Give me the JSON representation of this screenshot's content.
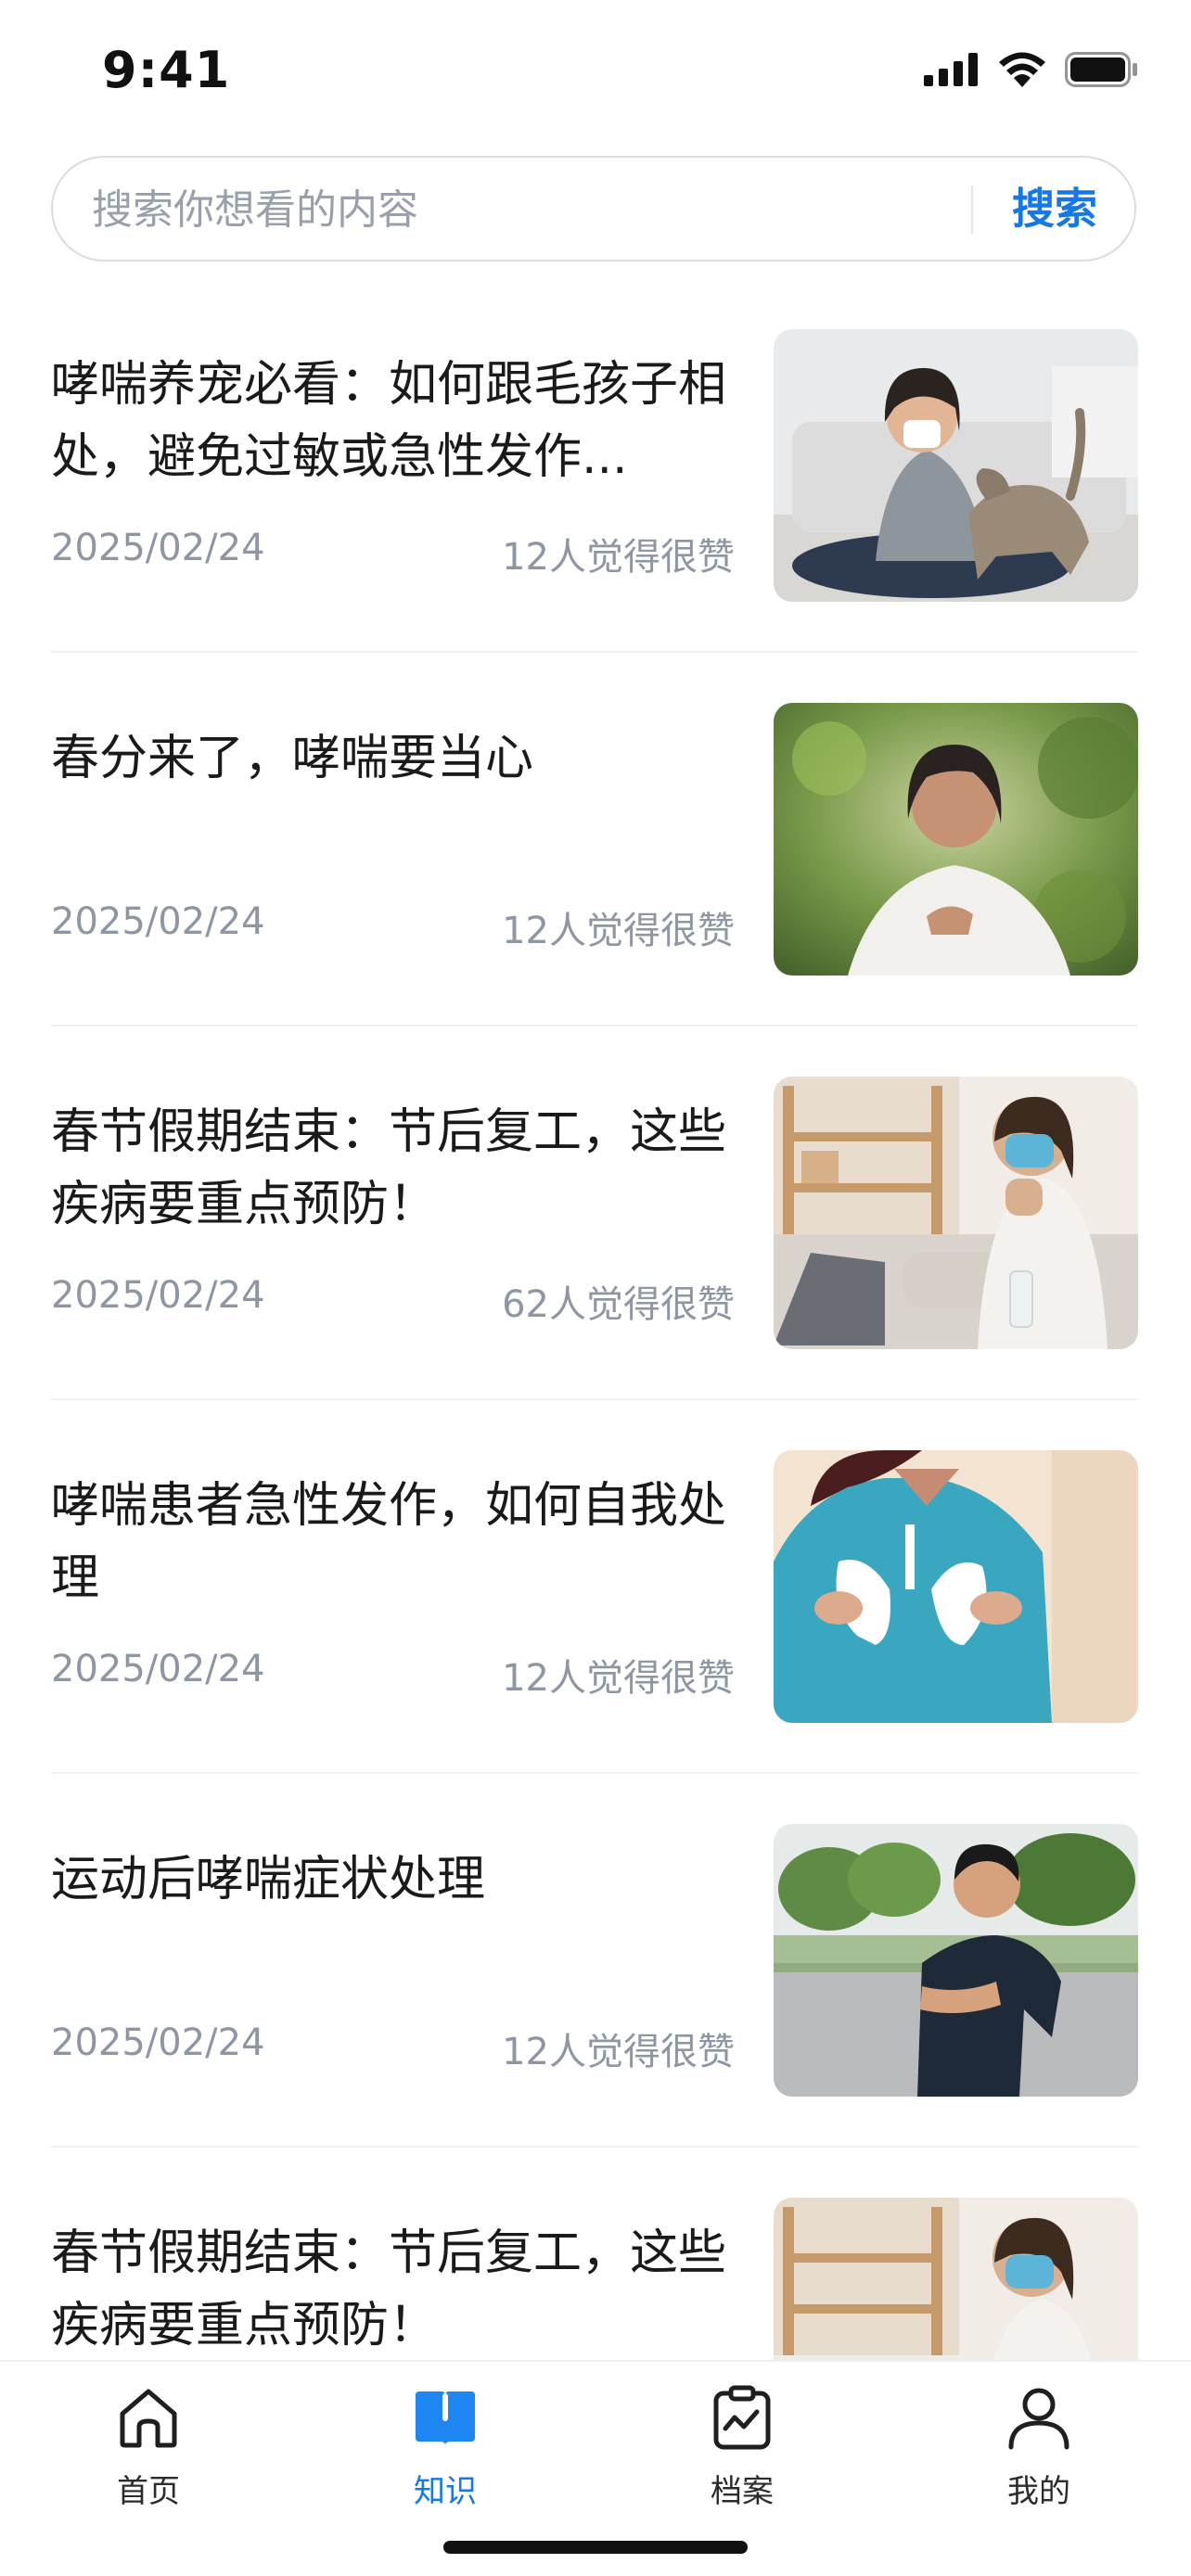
{
  "status_bar": {
    "time": "9:41"
  },
  "search": {
    "placeholder": "搜索你想看的内容",
    "button_label": "搜索"
  },
  "articles": [
    {
      "title": "哮喘养宠必看：如何跟毛孩子相处，避免过敏或急性发作...",
      "date": "2025/02/24",
      "likes": "12人觉得很赞",
      "image": "woman-sneezing-with-cat-photo"
    },
    {
      "title": "春分来了，哮喘要当心",
      "date": "2025/02/24",
      "likes": "12人觉得很赞",
      "image": "woman-breathing-outdoors-photo"
    },
    {
      "title": "春节假期结束：节后复工，这些疾病要重点预防！",
      "date": "2025/02/24",
      "likes": "62人觉得很赞",
      "image": "woman-with-mask-coughing-photo"
    },
    {
      "title": "哮喘患者急性发作，如何自我处理",
      "date": "2025/02/24",
      "likes": "12人觉得很赞",
      "image": "woman-holding-lung-model-photo"
    },
    {
      "title": "运动后哮喘症状处理",
      "date": "2025/02/24",
      "likes": "12人觉得很赞",
      "image": "man-chest-pain-after-run-photo"
    },
    {
      "title": "春节假期结束：节后复工，这些疾病要重点预防！",
      "date": "",
      "likes": "",
      "image": "woman-with-mask-coughing-photo"
    }
  ],
  "tab_bar": {
    "tabs": [
      {
        "label": "首页",
        "icon": "home-icon",
        "active": false
      },
      {
        "label": "知识",
        "icon": "book-icon",
        "active": true
      },
      {
        "label": "档案",
        "icon": "clipboard-chart-icon",
        "active": false
      },
      {
        "label": "我的",
        "icon": "user-icon",
        "active": false
      }
    ]
  },
  "colors": {
    "accent": "#1677e6",
    "text_primary": "#1a1a1a",
    "text_secondary": "#8f96a3",
    "divider": "#eef0f3"
  }
}
